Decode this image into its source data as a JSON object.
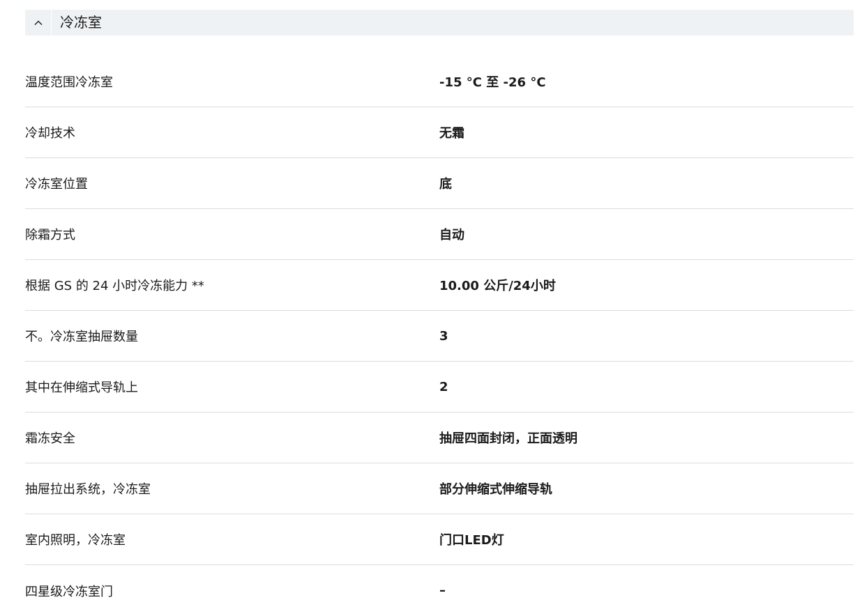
{
  "section": {
    "title": "冷冻室",
    "toggle_icon": "chevron-up-icon",
    "header_bg": "#eff2f5"
  },
  "specs": [
    {
      "label": "温度范围冷冻室",
      "value": "-15 °C 至 -26 °C"
    },
    {
      "label": "冷却技术",
      "value": "无霜"
    },
    {
      "label": "冷冻室位置",
      "value": "底"
    },
    {
      "label": "除霜方式",
      "value": "自动"
    },
    {
      "label": "根据 GS 的 24 小时冷冻能力 **",
      "value": "10.00 公斤/24小时"
    },
    {
      "label": "不。冷冻室抽屉数量",
      "value": "3"
    },
    {
      "label": "其中在伸缩式导轨上",
      "value": "2"
    },
    {
      "label": "霜冻安全",
      "value": "抽屉四面封闭，正面透明"
    },
    {
      "label": "抽屉拉出系统，冷冻室",
      "value": "部分伸缩式伸缩导轨"
    },
    {
      "label": "室内照明，冷冻室",
      "value": "门口LED灯"
    },
    {
      "label": "四星级冷冻室门",
      "value": "–"
    }
  ]
}
